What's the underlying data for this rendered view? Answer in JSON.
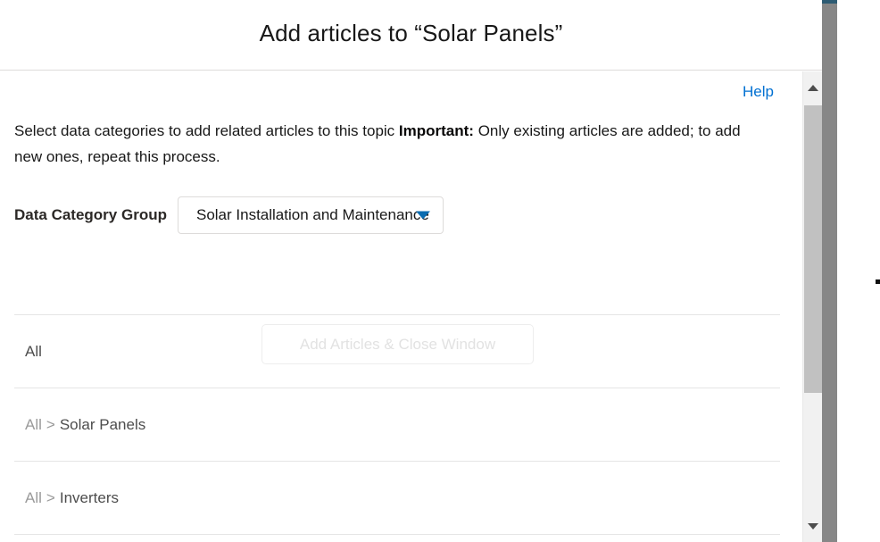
{
  "window": {
    "title": "Add articles to “Solar Panels”"
  },
  "body": {
    "help_link": "Help",
    "intro_part1": "Select data categories to add related articles to this topic ",
    "intro_strong": "Important:",
    "intro_part2": " Only existing articles are added; to add new ones, repeat this process."
  },
  "form": {
    "data_category_group_label": "Data Category Group",
    "data_category_group_value": "Solar Installation and Maintenance",
    "dropdown_icon": "caret-down-icon",
    "submit_label": "Add Articles & Close Window"
  },
  "categories": [
    {
      "crumb": [
        "All"
      ]
    },
    {
      "crumb": [
        "All",
        "Solar Panels"
      ]
    },
    {
      "crumb": [
        "All",
        "Inverters"
      ]
    }
  ],
  "breadcrumb_separator": ">",
  "scrollbar": {
    "up_icon": "chevron-up-icon",
    "down_icon": "chevron-down-icon"
  },
  "colors": {
    "link": "#0070d2",
    "dropdown_arrow": "#0b6cb0",
    "divider": "#dddbda",
    "row_divider": "#e5e5e5",
    "disabled_text": "#e2e2e2",
    "scrollbar_track": "#f1f1f1",
    "scrollbar_thumb": "#c1c1c1",
    "outer_scrollbar": "#878787"
  }
}
